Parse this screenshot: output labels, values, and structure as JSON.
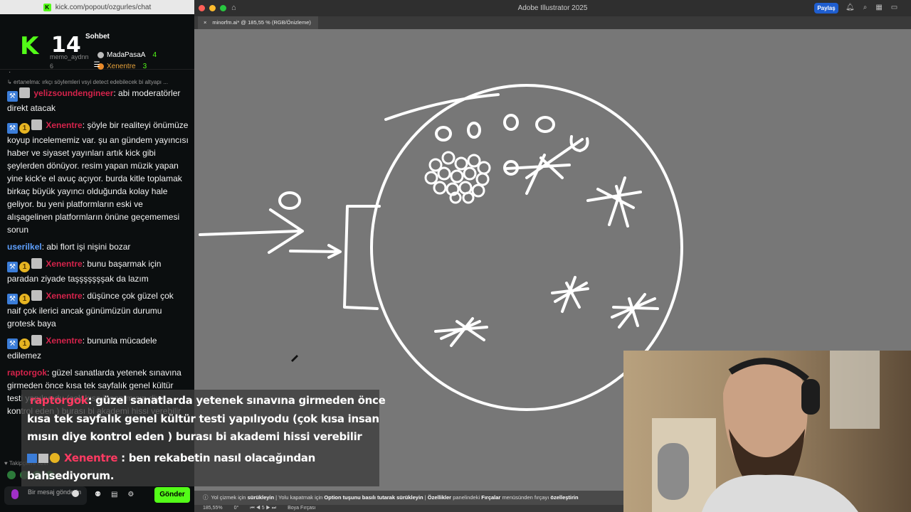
{
  "chat_window": {
    "url": "kick.com/popout/ozgurles/chat",
    "header": {
      "logo": "K",
      "logo_number": "14",
      "title": "Sohbet",
      "ghost_user": "memo_aydnn",
      "ghost_count": "6",
      "leaders": [
        {
          "name": "MadaPasaA",
          "count": "4"
        },
        {
          "name": "Xenentre",
          "count": "3"
        }
      ]
    },
    "pinned_reply": "ertanelma: ırkçı söylemleri vsyi detect edebilecek bi altyapı ...",
    "dot": "·",
    "messages": [
      {
        "user": "yelizsoundengineer",
        "color": "pink",
        "badges": [
          "blue",
          "gift"
        ],
        "text": "abi moderatörler direkt atacak"
      },
      {
        "user": "Xenentre",
        "color": "pink",
        "badges": [
          "blue",
          "gold",
          "gift"
        ],
        "text": "şöyle bir realiteyi önümüze koyup incelememiz var. şu an gündem yayıncısı haber ve siyaset yayınları artık kick gibi şeylerden dönüyor. resim yapan müzik yapan yine kick'e el avuç açıyor. burda kitle toplamak birkaç büyük yayıncı olduğunda kolay hale geliyor. bu yeni platformların eski ve alışagelinen platformların önüne geçememesi sorun"
      },
      {
        "user": "userilkel",
        "color": "blue",
        "badges": [],
        "text": "abi flort işi nişini bozar"
      },
      {
        "user": "Xenentre",
        "color": "pink",
        "badges": [
          "blue",
          "gold",
          "gift"
        ],
        "text": "bunu başarmak için paradan ziyade taşşşşşşşak da lazım"
      },
      {
        "user": "Xenentre",
        "color": "pink",
        "badges": [
          "blue",
          "gold",
          "gift"
        ],
        "text": "düşünce çok güzel çok naif çok ilerici ancak günümüzün durumu grotesk baya"
      },
      {
        "user": "Xenentre",
        "color": "pink",
        "badges": [
          "blue",
          "gold",
          "gift"
        ],
        "text": "bununla mücadele edilemez"
      },
      {
        "user": "raptorgok",
        "color": "pink",
        "badges": [],
        "text": "güzel sanatlarda yetenek sınavına girmeden önce kısa tek sayfalık genel kültür testi yapılıyodu (çok kısa insan mısın diye kontrol eden ) burası bi akademi hissi verebilir"
      }
    ],
    "follow_note": "Takipçilere özel",
    "input_placeholder": "Bir mesaj gönderin",
    "send_label": "Gönder",
    "accent": "#53fc18"
  },
  "illustrator": {
    "app_title": "Adobe Illustrator 2025",
    "share_label": "Paylaş",
    "doc_tab": "minorfm.ai* @ 185,55 % (RGB/Önizleme)",
    "tab_close": "×",
    "status_hint": {
      "a": "Yol çizmek için",
      "a_bold": "sürükleyin",
      "b": "Yolu kapatmak için",
      "b_bold": "Option tuşunu basılı tutarak sürükleyin",
      "c_bold": "Özellikler",
      "c": "panelindeki",
      "c_bold2": "Fırçalar",
      "d": "menüsünden fırçayı",
      "d_bold": "özelleştirin"
    },
    "bottom": {
      "zoom": "185,55%",
      "rotation": "0°",
      "artboard": "5",
      "tool": "Boya Fırçası"
    },
    "canvas_color": "#777777"
  },
  "subtitles": [
    {
      "name": "raptorgok",
      "text": ": güzel sanatlarda yetenek sınavına girmeden önce"
    },
    {
      "name": "",
      "text": "kısa tek sayfalık genel kültür testi yapılıyodu (çok kısa insan"
    },
    {
      "name": "",
      "text": "mısın diye kontrol eden ) burası bi akademi hissi verebilir"
    },
    {
      "name": "Xenentre",
      "text": ": ben rekabetin nasıl olacağından"
    },
    {
      "name": "",
      "text": "bahsediyorum."
    }
  ]
}
